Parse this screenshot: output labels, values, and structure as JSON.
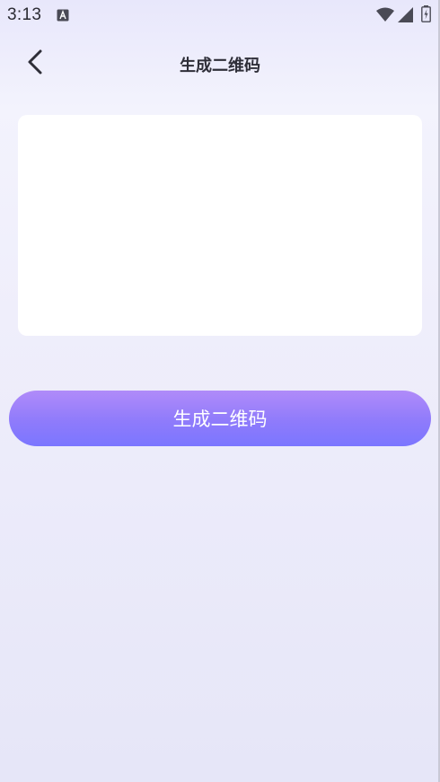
{
  "status_bar": {
    "time": "3:13",
    "icons": [
      "notification-a-icon",
      "wifi-icon",
      "signal-icon",
      "battery-icon"
    ]
  },
  "nav": {
    "back_icon": "chevron-left-icon",
    "title": "生成二维码"
  },
  "input": {
    "value": "",
    "placeholder": ""
  },
  "actions": {
    "generate_label": "生成二维码"
  },
  "colors": {
    "button_gradient_start": "#b08bf9",
    "button_gradient_end": "#7b76ff",
    "title_text": "#2e2e38",
    "card_background": "#ffffff"
  }
}
